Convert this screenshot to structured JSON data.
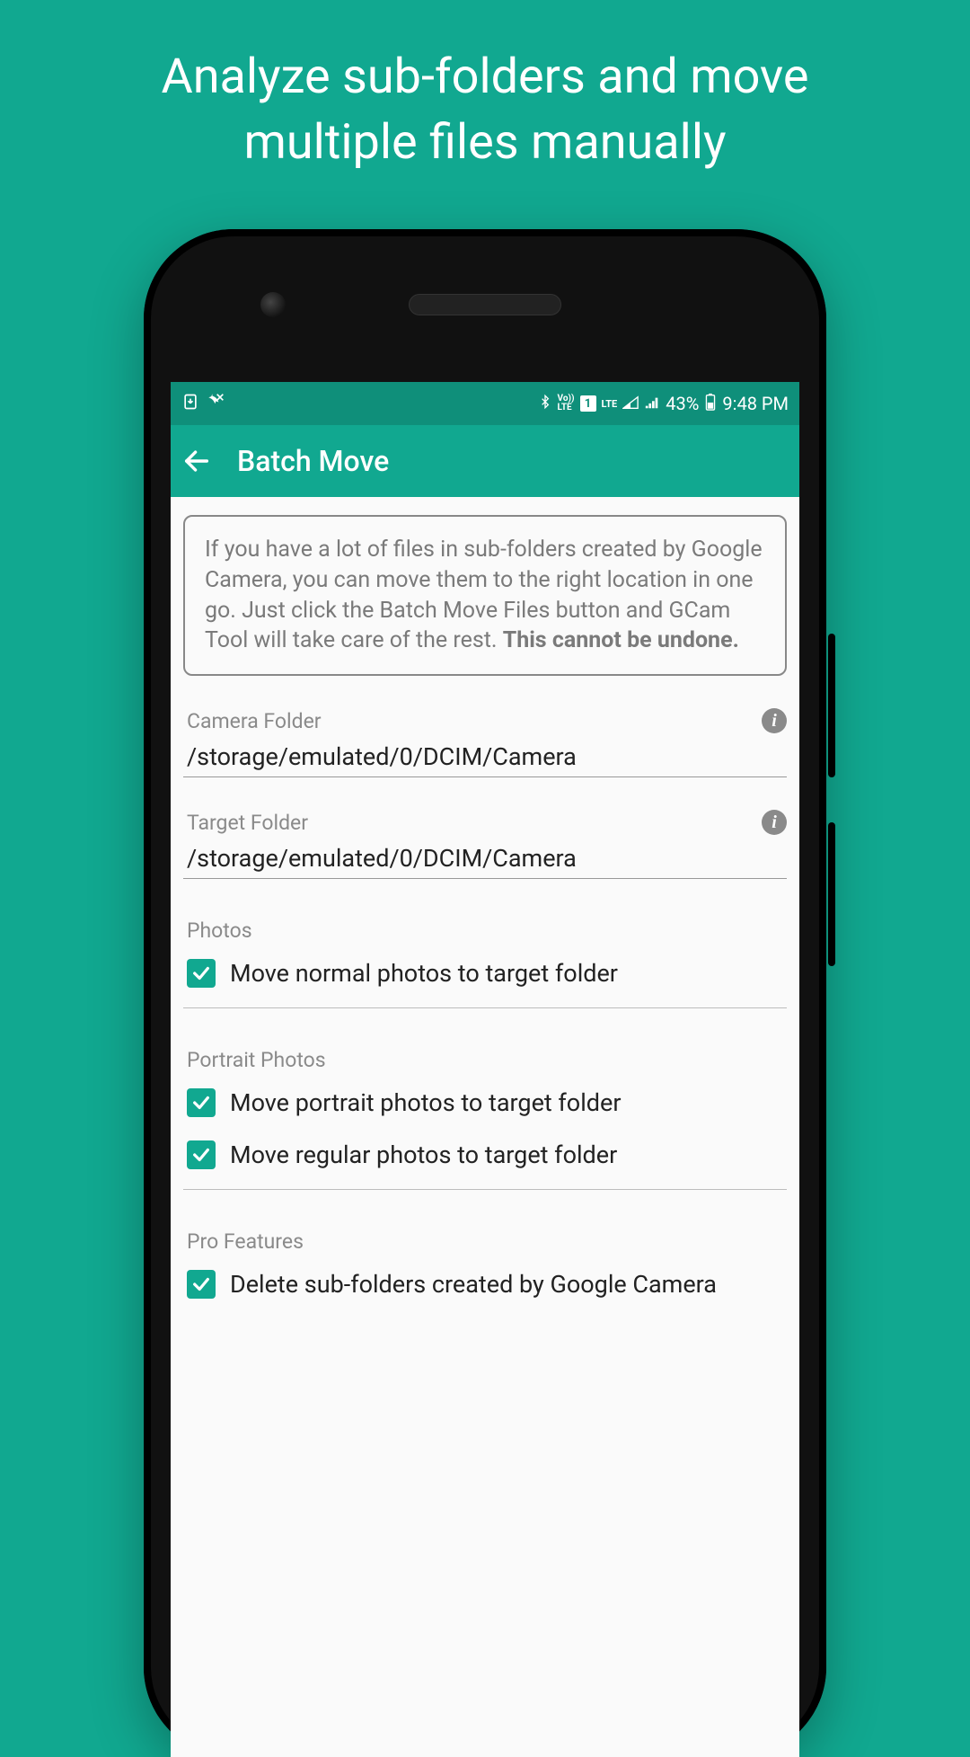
{
  "promo": {
    "line1": "Analyze sub-folders and move",
    "line2": "multiple files manually"
  },
  "status_bar": {
    "volte": "Vo))\nLTE",
    "sim": "1",
    "lte": "LTE",
    "battery_pct": "43%",
    "time": "9:48 PM"
  },
  "app_bar": {
    "title": "Batch Move"
  },
  "info": {
    "text": "If you have a lot of files in sub-folders created by Google Camera, you can move them to the right location in one go. Just click the Batch Move Files button and GCam Tool will take care of the rest. ",
    "bold": "This cannot be undone."
  },
  "fields": {
    "camera": {
      "label": "Camera Folder",
      "value": "/storage/emulated/0/DCIM/Camera"
    },
    "target": {
      "label": "Target Folder",
      "value": "/storage/emulated/0/DCIM/Camera"
    }
  },
  "groups": {
    "photos": {
      "title": "Photos",
      "opt1": "Move normal photos to target folder"
    },
    "portrait": {
      "title": "Portrait Photos",
      "opt1": "Move portrait photos to target folder",
      "opt2": "Move regular photos to target folder"
    },
    "pro": {
      "title": "Pro Features",
      "opt1": "Delete sub-folders created by Google Camera"
    }
  }
}
